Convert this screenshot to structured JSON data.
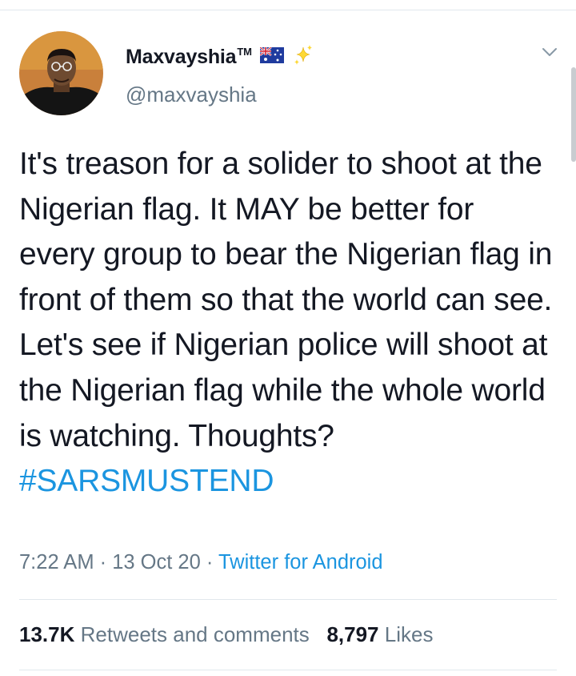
{
  "user": {
    "display_name": "Maxvayshia",
    "tm": "TM",
    "handle": "@maxvayshia",
    "badges": [
      "australia-flag-icon",
      "sparkles-icon"
    ]
  },
  "tweet": {
    "text": "It's treason for a solider to shoot at the Nigerian flag. It MAY be better for every group to bear the Nigerian flag in front of them so that the world can see. Let's see if Nigerian police will shoot at the Nigerian flag while the whole world is watching. Thoughts?",
    "hashtag": "#SARSMUSTEND"
  },
  "meta": {
    "time": "7:22 AM",
    "sep1": " · ",
    "date": "13 Oct 20",
    "sep2": " · ",
    "source": "Twitter for Android"
  },
  "stats": {
    "retweets_count": "13.7K",
    "retweets_label": "Retweets and comments",
    "likes_count": "8,797",
    "likes_label": "Likes"
  },
  "colors": {
    "link": "#1b95e0",
    "secondary": "#657786",
    "primary": "#141823",
    "divider": "#e1e8ed"
  }
}
